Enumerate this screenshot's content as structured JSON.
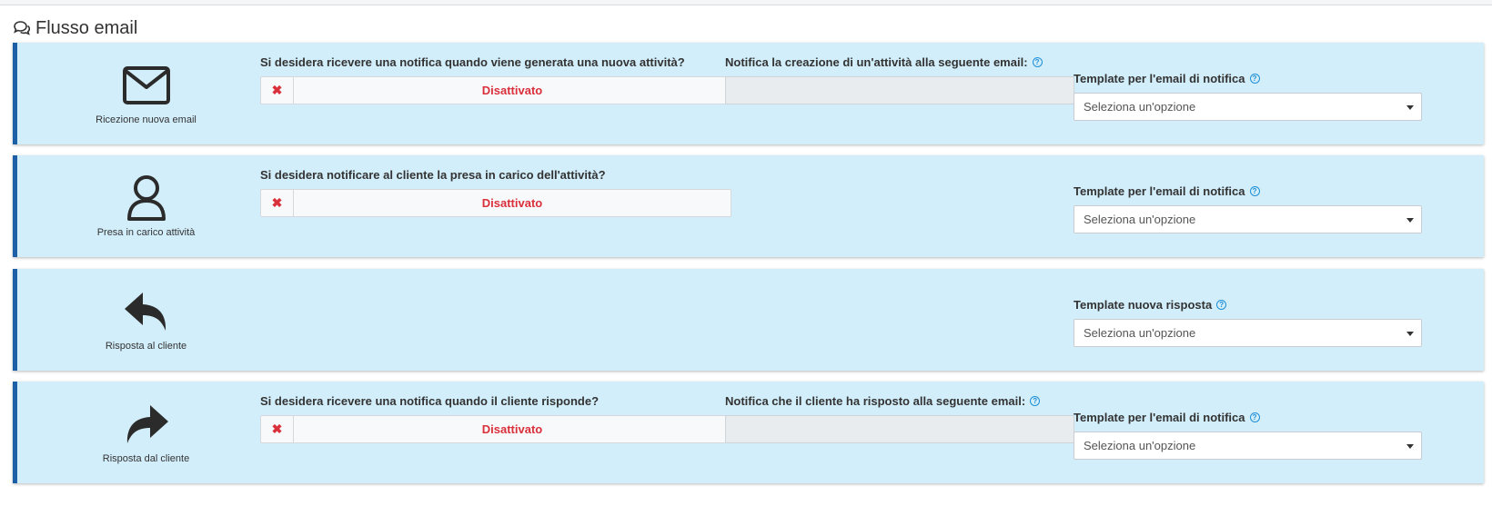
{
  "section": {
    "title": "Flusso email",
    "icon": "comments-icon"
  },
  "toggle_off_label": "Disattivato",
  "select_placeholder": "Seleziona un'opzione",
  "cards": [
    {
      "icon": "envelope-icon",
      "caption": "Ricezione nuova email",
      "question": "Si desidera ricevere una notifica quando viene generata una nuova attività?",
      "email_label": "Notifica la creazione di un'attività alla seguente email:",
      "template_label": "Template per l'email di notifica"
    },
    {
      "icon": "user-icon",
      "caption": "Presa in carico attività",
      "question": "Si desidera notificare al cliente la presa in carico dell'attività?",
      "template_label": "Template per l'email di notifica"
    },
    {
      "icon": "reply-icon",
      "caption": "Risposta al cliente",
      "template_label": "Template nuova risposta"
    },
    {
      "icon": "forward-icon",
      "caption": "Risposta dal cliente",
      "question": "Si desidera ricevere una notifica quando il cliente risponde?",
      "email_label": "Notifica che il cliente ha risposto alla seguente email:",
      "template_label": "Template per l'email di notifica"
    }
  ]
}
